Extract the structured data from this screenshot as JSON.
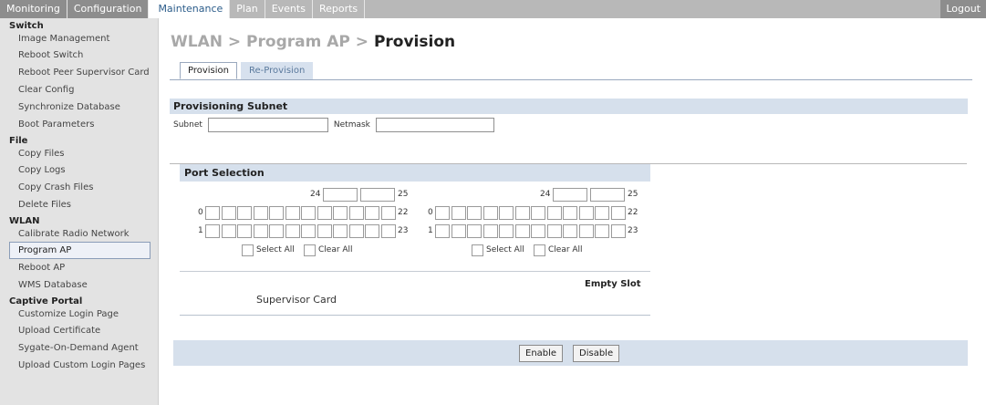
{
  "topnav": {
    "tabs": [
      "Monitoring",
      "Configuration",
      "Maintenance",
      "Plan",
      "Events",
      "Reports"
    ],
    "active": "Maintenance",
    "logout": "Logout"
  },
  "sidebar": {
    "switch": {
      "title": "Switch",
      "items": [
        "Image Management",
        "Reboot Switch",
        "Reboot Peer Supervisor Card",
        "Clear Config",
        "Synchronize Database",
        "Boot Parameters"
      ]
    },
    "file": {
      "title": "File",
      "items": [
        "Copy Files",
        "Copy Logs",
        "Copy Crash Files",
        "Delete Files"
      ]
    },
    "wlan": {
      "title": "WLAN",
      "items": [
        "Calibrate Radio Network",
        "Program AP",
        "Reboot AP",
        "WMS Database"
      ]
    },
    "captive": {
      "title": "Captive Portal",
      "items": [
        "Customize Login Page",
        "Upload Certificate",
        "Sygate-On-Demand Agent",
        "Upload Custom Login Pages"
      ]
    },
    "active_item": "Program AP"
  },
  "main": {
    "title_path": "WLAN > Program AP > ",
    "title_last": "Provision",
    "subtabs": [
      "Provision",
      "Re-Provision"
    ],
    "provisioning_subnet": {
      "title": "Provisioning Subnet",
      "subnet_label": "Subnet",
      "subnet_value": "",
      "netmask_label": "Netmask",
      "netmask_value": ""
    },
    "port_selection": {
      "title": "Port Selection",
      "left_slot": {
        "top_start": "24",
        "top_end": "25",
        "row0_start": "0",
        "row0_end": "22",
        "row1_start": "1",
        "row1_end": "23"
      },
      "right_slot": {
        "top_start": "24",
        "top_end": "25",
        "row0_start": "0",
        "row0_end": "22",
        "row1_start": "1",
        "row1_end": "23"
      },
      "select_all": "Select All",
      "clear_all": "Clear All",
      "supervisor_card": "Supervisor Card",
      "empty_slot": "Empty Slot"
    },
    "buttons": {
      "enable": "Enable",
      "disable": "Disable"
    }
  }
}
